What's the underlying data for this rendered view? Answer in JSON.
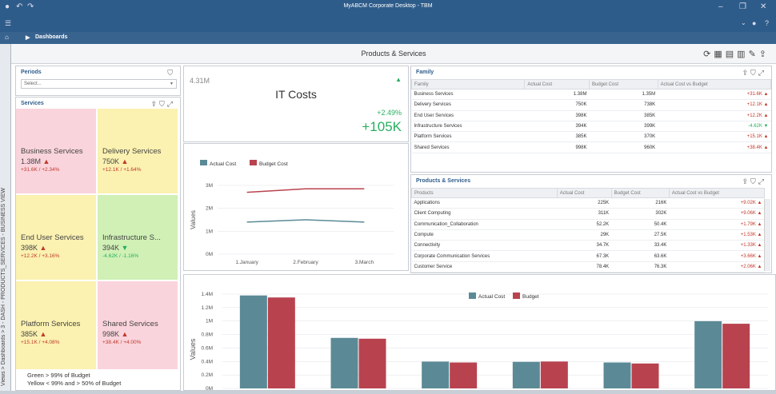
{
  "window": {
    "title": "MyABCM Corporate Desktop - TBM"
  },
  "nav": {
    "breadcrumb": "Dashboards"
  },
  "side": {
    "vertical_label": "Views > Dashboards > 3 - DASH - PRODUCTS_SERVICES - BUSINESS VIEW"
  },
  "dashboard": {
    "title": "Products & Services"
  },
  "periods": {
    "title": "Periods",
    "placeholder": "Select..."
  },
  "services": {
    "title": "Services",
    "tiles": [
      {
        "name": "Business Services",
        "value": "1.38M",
        "trend": "up",
        "delta": "+31.6K / +2.34%",
        "color": "#fad4dc"
      },
      {
        "name": "Delivery Services",
        "value": "750K",
        "trend": "up",
        "delta": "+12.1K / +1.64%",
        "color": "#fbf1b0"
      },
      {
        "name": "End User Services",
        "value": "398K",
        "trend": "up",
        "delta": "+12.2K / +3.16%",
        "color": "#fbf1b0"
      },
      {
        "name": "Infrastructure S...",
        "value": "394K",
        "trend": "down",
        "delta": "-4.62K / -1.16%",
        "color": "#d0f0b6"
      },
      {
        "name": "Platform Services",
        "value": "385K",
        "trend": "up",
        "delta": "+15.1K / +4.08%",
        "color": "#fbf1b0"
      },
      {
        "name": "Shared Services",
        "value": "998K",
        "trend": "up",
        "delta": "+38.4K / +4.00%",
        "color": "#fad4dc"
      }
    ],
    "legend": [
      "Green > 99% of Budget",
      "Yellow < 99% and > 50% of Budget"
    ]
  },
  "itcosts": {
    "left_value": "4.31M",
    "title": "IT Costs",
    "pct": "+2.49%",
    "abs": "+105K"
  },
  "family": {
    "title": "Family",
    "columns": [
      "Family",
      "Actual Cost",
      "Budget Cost",
      "Actual Cost vs Budget"
    ],
    "rows": [
      {
        "name": "Business Services",
        "actual": "1.38M",
        "budget": "1.35M",
        "diff": "+31.6K",
        "trend": "up"
      },
      {
        "name": "Delivery Services",
        "actual": "750K",
        "budget": "738K",
        "diff": "+12.1K",
        "trend": "up"
      },
      {
        "name": "End User Services",
        "actual": "398K",
        "budget": "385K",
        "diff": "+12.2K",
        "trend": "up"
      },
      {
        "name": "Infrastructure Services",
        "actual": "394K",
        "budget": "399K",
        "diff": "-4.62K",
        "trend": "down"
      },
      {
        "name": "Platform Services",
        "actual": "385K",
        "budget": "370K",
        "diff": "+15.1K",
        "trend": "up"
      },
      {
        "name": "Shared Services",
        "actual": "998K",
        "budget": "960K",
        "diff": "+38.4K",
        "trend": "up"
      }
    ]
  },
  "products": {
    "title": "Products & Services",
    "columns": [
      "Products",
      "Actual Cost",
      "Budget Cost",
      "Actual Cost vs Budget"
    ],
    "rows": [
      {
        "name": "Applications",
        "actual": "225K",
        "budget": "216K",
        "diff": "+9.02K",
        "trend": "up"
      },
      {
        "name": "Client Computing",
        "actual": "311K",
        "budget": "302K",
        "diff": "+9.06K",
        "trend": "up"
      },
      {
        "name": "Communication_Collaboration",
        "actual": "52.2K",
        "budget": "50.4K",
        "diff": "+1.79K",
        "trend": "up"
      },
      {
        "name": "Compute",
        "actual": "29K",
        "budget": "27.5K",
        "diff": "+1.53K",
        "trend": "up"
      },
      {
        "name": "Connectivity",
        "actual": "34.7K",
        "budget": "33.4K",
        "diff": "+1.33K",
        "trend": "up"
      },
      {
        "name": "Corporate Communication Services",
        "actual": "67.3K",
        "budget": "63.6K",
        "diff": "+3.66K",
        "trend": "up"
      },
      {
        "name": "Customer Service",
        "actual": "78.4K",
        "budget": "76.3K",
        "diff": "+2.06K",
        "trend": "up"
      }
    ]
  },
  "colors": {
    "actual": "#5b8a96",
    "budget": "#b8434f",
    "accent": "#2e5c8a"
  },
  "chart_data": [
    {
      "type": "line",
      "categories": [
        "1.January",
        "2.February",
        "3.March"
      ],
      "series": [
        {
          "name": "Actual Cost",
          "values": [
            1.4,
            1.5,
            1.4
          ]
        },
        {
          "name": "Budget Cost",
          "values": [
            2.7,
            2.85,
            2.85
          ]
        }
      ],
      "ylabel": "Values",
      "yticks": [
        "0M",
        "1M",
        "2M",
        "3M"
      ],
      "ylim": [
        0,
        3
      ]
    },
    {
      "type": "bar",
      "categories": [
        "",
        "",
        "",
        "",
        "",
        ""
      ],
      "series": [
        {
          "name": "Actual Cost",
          "values": [
            1.38,
            0.75,
            0.398,
            0.394,
            0.385,
            0.998
          ]
        },
        {
          "name": "Budget",
          "values": [
            1.35,
            0.738,
            0.385,
            0.399,
            0.37,
            0.96
          ]
        }
      ],
      "ylabel": "Values",
      "yticks": [
        "0M",
        "0.2M",
        "0.4M",
        "0.6M",
        "0.8M",
        "1M",
        "1.2M",
        "1.4M"
      ],
      "ylim": [
        0,
        1.4
      ]
    }
  ]
}
